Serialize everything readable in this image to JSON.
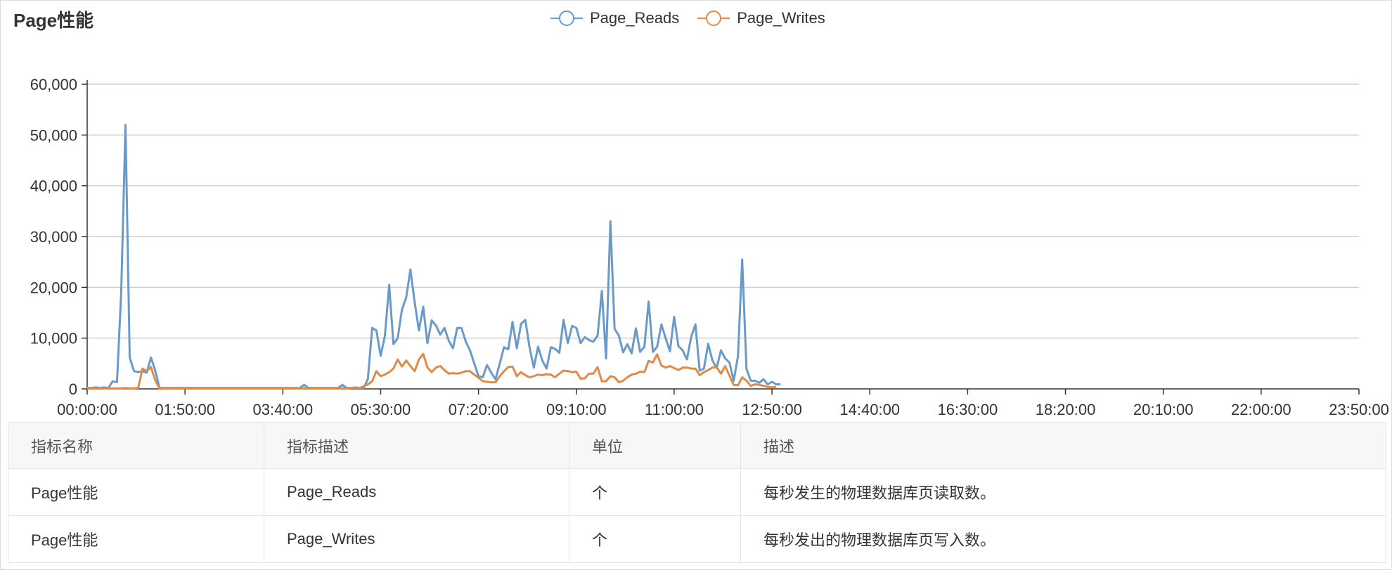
{
  "title": "Page性能",
  "legend": [
    {
      "label": "Page_Reads",
      "color": "#6a9ac9"
    },
    {
      "label": "Page_Writes",
      "color": "#e08a4a"
    }
  ],
  "chart_data": {
    "type": "line",
    "title": "Page性能",
    "xlabel": "",
    "ylabel": "",
    "ylim": [
      0,
      60000
    ],
    "yticks": [
      0,
      10000,
      20000,
      30000,
      40000,
      50000,
      60000
    ],
    "ytick_labels": [
      "0",
      "10,000",
      "20,000",
      "30,000",
      "40,000",
      "50,000",
      "60,000"
    ],
    "xtick_labels": [
      "00:00:00",
      "01:50:00",
      "03:40:00",
      "05:30:00",
      "07:20:00",
      "09:10:00",
      "11:00:00",
      "12:50:00",
      "14:40:00",
      "16:30:00",
      "18:20:00",
      "20:10:00",
      "22:00:00",
      "23:50:00"
    ],
    "x_interval_minutes": 10,
    "grid": true,
    "legend_position": "top-center",
    "series": [
      {
        "name": "Page_Reads",
        "color": "#6a9ac9",
        "values": [
          200,
          200,
          300,
          200,
          300,
          200,
          1500,
          1300,
          19000,
          52000,
          6200,
          3500,
          3300,
          3500,
          3200,
          6200,
          3600,
          200,
          200,
          200,
          200,
          200,
          200,
          200,
          200,
          200,
          200,
          200,
          200,
          200,
          200,
          200,
          200,
          200,
          200,
          200,
          200,
          200,
          200,
          200,
          200,
          200,
          200,
          200,
          200,
          200,
          200,
          200,
          200,
          200,
          200,
          800,
          200,
          200,
          200,
          200,
          200,
          200,
          200,
          200,
          800,
          200,
          200,
          200,
          200,
          200,
          2000,
          12000,
          11500,
          6500,
          10500,
          20500,
          8800,
          10000,
          15600,
          18000,
          23500,
          17000,
          11500,
          16200,
          9000,
          13500,
          12500,
          10700,
          12000,
          9500,
          8000,
          12000,
          12000,
          9300,
          7600,
          5000,
          2500,
          2300,
          4700,
          3200,
          1900,
          5000,
          8200,
          7800,
          13200,
          8000,
          12800,
          13600,
          8200,
          4200,
          8300,
          5600,
          4000,
          8200,
          7900,
          7100,
          13600,
          9000,
          12400,
          12000,
          9000,
          10200,
          9600,
          9300,
          10500,
          19300,
          6000,
          33000,
          11800,
          10500,
          7200,
          8800,
          7000,
          11900,
          7300,
          8300,
          17200,
          7300,
          8300,
          12700,
          10000,
          7400,
          14200,
          8400,
          7600,
          5800,
          10200,
          12700,
          3600,
          4000,
          8900,
          5600,
          4100,
          7600,
          6000,
          5200,
          1600,
          6400,
          25500,
          4000,
          1600,
          1600,
          1200,
          1900,
          900,
          1400,
          900,
          900
        ]
      },
      {
        "name": "Page_Writes",
        "color": "#e08a4a",
        "values": [
          100,
          100,
          100,
          100,
          100,
          100,
          100,
          100,
          100,
          200,
          100,
          100,
          200,
          4000,
          3500,
          4300,
          1700,
          100,
          100,
          100,
          100,
          100,
          100,
          100,
          100,
          100,
          100,
          100,
          100,
          100,
          100,
          100,
          100,
          100,
          100,
          100,
          100,
          100,
          100,
          100,
          100,
          100,
          100,
          100,
          100,
          100,
          100,
          100,
          100,
          100,
          100,
          100,
          100,
          100,
          100,
          100,
          100,
          100,
          100,
          100,
          100,
          100,
          200,
          300,
          200,
          500,
          900,
          1500,
          3500,
          2500,
          2800,
          3300,
          4000,
          5800,
          4400,
          5600,
          4500,
          3500,
          5800,
          6900,
          4200,
          3300,
          4200,
          4500,
          3700,
          3000,
          3100,
          3000,
          3200,
          3500,
          3500,
          2800,
          2200,
          1500,
          1400,
          1300,
          1300,
          2500,
          3500,
          4300,
          4400,
          2500,
          3300,
          2700,
          2300,
          2500,
          2800,
          2700,
          2900,
          2800,
          2300,
          3000,
          3600,
          3500,
          3300,
          3400,
          2000,
          2100,
          3000,
          3000,
          4300,
          1500,
          1500,
          2500,
          2300,
          1300,
          1600,
          2300,
          2800,
          3000,
          3400,
          3300,
          5500,
          5200,
          6800,
          4600,
          4200,
          4500,
          4100,
          3700,
          4200,
          4200,
          4000,
          4000,
          2700,
          3300,
          3700,
          4200,
          4300,
          3000,
          4500,
          2600,
          800,
          700,
          2300,
          1600,
          600,
          900,
          800,
          600,
          400,
          300,
          400
        ]
      }
    ]
  },
  "table": {
    "headers": [
      "指标名称",
      "指标描述",
      "单位",
      "描述"
    ],
    "rows": [
      [
        "Page性能",
        "Page_Reads",
        "个",
        "每秒发生的物理数据库页读取数。"
      ],
      [
        "Page性能",
        "Page_Writes",
        "个",
        "每秒发出的物理数据库页写入数。"
      ]
    ]
  }
}
